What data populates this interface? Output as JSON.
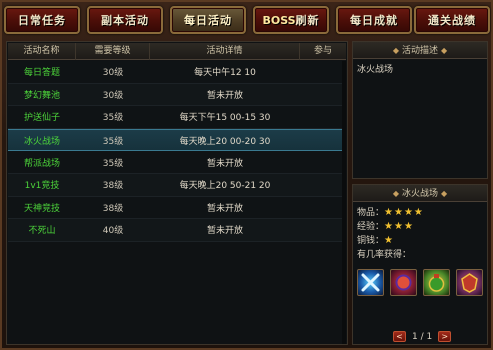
{
  "tabs": [
    {
      "label": "日常任务",
      "active": false
    },
    {
      "label": "副本活动",
      "active": false
    },
    {
      "label": "每日活动",
      "active": true
    },
    {
      "label_prefix": "BOSS",
      "label": "刷新",
      "active": false
    },
    {
      "label": "每日成就",
      "active": false
    },
    {
      "label": "通关战绩",
      "active": false
    }
  ],
  "table": {
    "headers": [
      "活动名称",
      "需要等级",
      "活动详情",
      "参与"
    ],
    "rows": [
      {
        "name": "每日答题",
        "level": "30级",
        "detail": "每天中午12 10"
      },
      {
        "name": "梦幻舞池",
        "level": "30级",
        "detail": "暂未开放"
      },
      {
        "name": "护送仙子",
        "level": "35级",
        "detail": "每天下午15 00-15 30"
      },
      {
        "name": "冰火战场",
        "level": "35级",
        "detail": "每天晚上20 00-20 30",
        "selected": true
      },
      {
        "name": "帮派战场",
        "level": "35级",
        "detail": "暂未开放"
      },
      {
        "name": "1v1竞技",
        "level": "38级",
        "detail": "每天晚上20 50-21 20"
      },
      {
        "name": "天神竞技",
        "level": "38级",
        "detail": "暂未开放"
      },
      {
        "name": "不死山",
        "level": "40级",
        "detail": "暂未开放"
      }
    ]
  },
  "description": {
    "header": "活动描述",
    "text": "冰火战场"
  },
  "rewards": {
    "title": "冰火战场",
    "items_label": "物品：",
    "items_stars": 4,
    "exp_label": "经验：",
    "exp_stars": 3,
    "coin_label": "铜钱：",
    "coin_stars": 1,
    "chance_label": "有几率获得：",
    "icons": [
      "crossed-blades-icon",
      "red-orb-icon",
      "green-pouch-icon",
      "red-crest-icon"
    ]
  },
  "pager": {
    "text": "1 / 1"
  },
  "colors": {
    "activity_name": "#4cd33a",
    "star": "#f0c030",
    "selected_row": "#1c3c48"
  }
}
